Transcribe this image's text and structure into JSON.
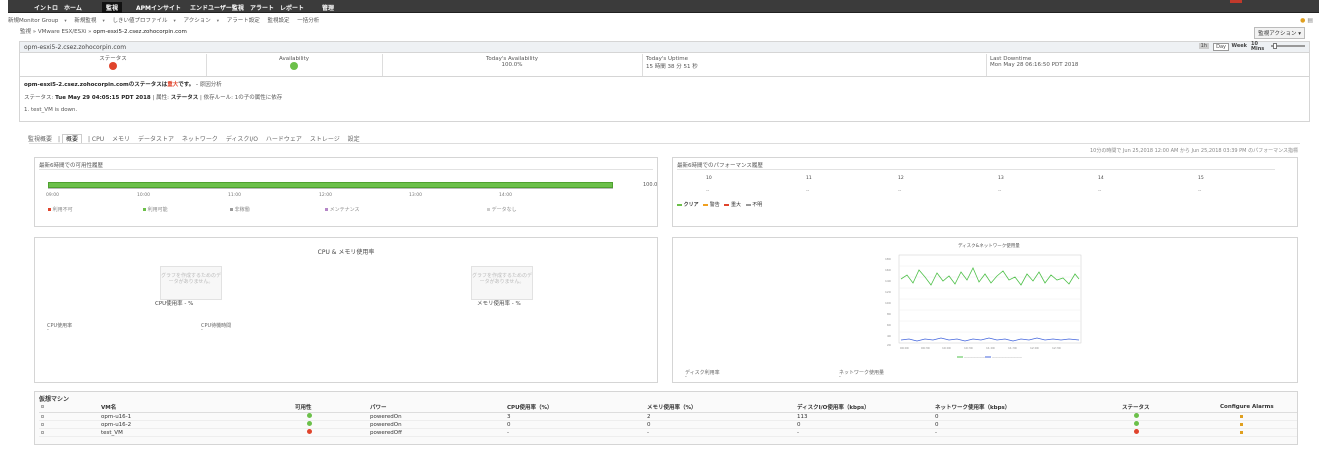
{
  "topnav": {
    "items": [
      "イントロ",
      "ホーム",
      "監視",
      "APMインサイト",
      "エンドユーザー監視",
      "アラート",
      "レポート",
      "管理"
    ],
    "active": "監視"
  },
  "subnav": [
    "新規Monitor Group",
    "新規監視",
    "しきい値プロファイル",
    "アクション",
    "アラート設定",
    "監視設定",
    "一括分析"
  ],
  "breadcrumb": {
    "path": "監視 » VMware ESX/ESXi » ",
    "current": "opm-esxi5-2.csez.zohocorpin.com"
  },
  "monitor_actions": "監視アクション",
  "header": {
    "host": "opm-esxi5-2.csez.zohocorpin.com",
    "period": {
      "options": [
        "1h",
        "Day",
        "Week"
      ],
      "selected": "Day",
      "interval": "10 Mins"
    },
    "status_label": "ステータス",
    "availability_label": "Availability",
    "todays_availability_label": "Today's Availability",
    "todays_availability_value": "100.0%",
    "todays_uptime_label": "Today's Uptime",
    "todays_uptime_value": "15 時間 38 分 51 秒",
    "last_downtime_label": "Last Downtime",
    "last_downtime_value": "Mon May 28 06:16:50 PDT 2018"
  },
  "rca": {
    "title_prefix": "opm-esxi5-2.csez.zohocorpin.comのステータスは",
    "title_state": "重大",
    "title_suffix": "です。",
    "root_cause_link": "原因分析",
    "line_label": "ステータス",
    "line_time": "Tue May 29 04:05:15 PDT 2018",
    "line_attr_label": "属性:",
    "line_attr": "ステータス",
    "line_rule_label": "依存ルール:",
    "line_rule": "1の子の属性に依存",
    "detail": "1. test_VM is down."
  },
  "tabs": [
    "監視概要",
    "概要",
    "CPU",
    "メモリ",
    "データストア",
    "ネットワーク",
    "ディスクI/O",
    "ハードウェア",
    "ストレージ",
    "設定"
  ],
  "tab_selected": "概要",
  "perf_period_note": "10分の時間で Jun 25,2018 12:00 AM から Jun 25,2018 03:39 PM のパフォーマンス指標",
  "availability_panel": {
    "title": "最新6時間での可用性履歴",
    "value_label": "100.0",
    "times": [
      "09:00",
      "10:00",
      "11:00",
      "12:00",
      "13:00",
      "14:00"
    ],
    "legend": [
      "利用不可",
      "利用可能",
      "非稼働",
      "メンテナンス",
      "データなし"
    ]
  },
  "performance_panel": {
    "title": "最新6時間でのパフォーマンス履歴",
    "hours": [
      "10",
      "11",
      "12",
      "13",
      "14",
      "15"
    ],
    "cells": [
      "--",
      "--",
      "--",
      "--",
      "--",
      "--"
    ],
    "legend": [
      "クリア",
      "警告",
      "重大",
      "不明"
    ]
  },
  "cpu_mem_panel": {
    "title": "CPU & メモリ使用率",
    "placeholder": "グラフを作成するためのデータがありません。",
    "cpu_gauge_label": "CPU使用率 - %",
    "mem_gauge_label": "メモリ使用率 - %",
    "cpu_usage_label": "CPU使用率",
    "cpu_usage_value": "-",
    "cpu_ready_label": "CPU待機時間",
    "cpu_ready_value": "-"
  },
  "disk_net_panel": {
    "title": "ディスク&ネットワーク使用量",
    "disk_label": "ディスク利用率",
    "disk_value": "-",
    "net_label": "ネットワーク使用量",
    "net_value": "-"
  },
  "vm_table": {
    "title": "仮想マシン",
    "headers": [
      "VM名",
      "可用性",
      "パワー",
      "CPU使用率（%）",
      "メモリ使用率（%）",
      "ディスクI/O使用率（kbps）",
      "ネットワーク使用率（kbps）",
      "ステータス",
      "Configure Alarms"
    ],
    "rows": [
      {
        "name": "opm-u16-1",
        "availability": "green",
        "power": "poweredOn",
        "cpu": "3",
        "mem": "2",
        "disk": "113",
        "net": "0",
        "status": "green"
      },
      {
        "name": "opm-u16-2",
        "availability": "green",
        "power": "poweredOn",
        "cpu": "0",
        "mem": "0",
        "disk": "0",
        "net": "0",
        "status": "green"
      },
      {
        "name": "test_VM",
        "availability": "red",
        "power": "poweredOff",
        "cpu": "-",
        "mem": "-",
        "disk": "-",
        "net": "-",
        "status": "red"
      }
    ]
  },
  "colors": {
    "accent_green": "#6cc04a",
    "critical_red": "#e0442c",
    "topbar": "#3b3b3b"
  }
}
